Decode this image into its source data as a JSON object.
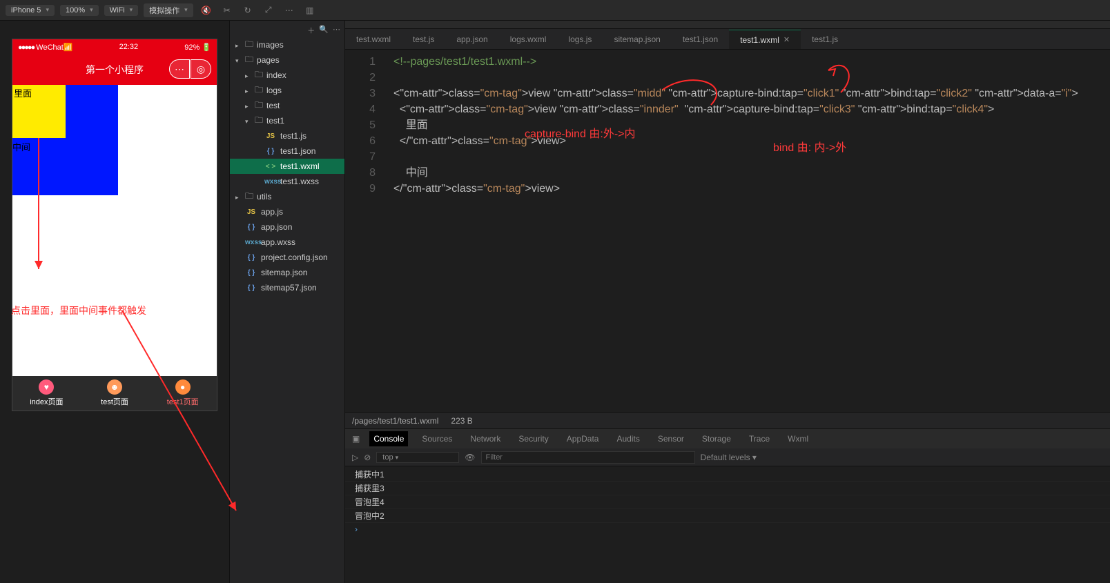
{
  "toolbar": {
    "device": "iPhone 5",
    "zoom": "100%",
    "network": "WiFi",
    "mock": "模拟操作"
  },
  "simulator": {
    "status": {
      "carrier": "WeChat",
      "time": "22:32",
      "battery": "92%"
    },
    "nav_title": "第一个小程序",
    "inner_text": "里面",
    "mid_text": "中间",
    "annotation": "点击里面，里面中间事件都触发",
    "tabs": [
      "index页面",
      "test页面",
      "test1页面"
    ]
  },
  "tree": {
    "root": [
      {
        "name": "images",
        "type": "folder"
      },
      {
        "name": "pages",
        "type": "folder",
        "open": true,
        "children": [
          {
            "name": "index",
            "type": "folder"
          },
          {
            "name": "logs",
            "type": "folder"
          },
          {
            "name": "test",
            "type": "folder"
          },
          {
            "name": "test1",
            "type": "folder",
            "open": true,
            "children": [
              {
                "name": "test1.js",
                "kind": "js"
              },
              {
                "name": "test1.json",
                "kind": "json"
              },
              {
                "name": "test1.wxml",
                "kind": "wxml",
                "active": true
              },
              {
                "name": "test1.wxss",
                "kind": "wxss"
              }
            ]
          }
        ]
      },
      {
        "name": "utils",
        "type": "folder"
      },
      {
        "name": "app.js",
        "kind": "js"
      },
      {
        "name": "app.json",
        "kind": "json"
      },
      {
        "name": "app.wxss",
        "kind": "wxss"
      },
      {
        "name": "project.config.json",
        "kind": "json"
      },
      {
        "name": "sitemap.json",
        "kind": "json"
      },
      {
        "name": "sitemap57.json",
        "kind": "json"
      }
    ]
  },
  "editor_tabs": [
    "test.wxml",
    "test.js",
    "app.json",
    "logs.wxml",
    "logs.js",
    "sitemap.json",
    "test1.json",
    "test1.wxml",
    "test1.js"
  ],
  "editor_tab_active": "test1.wxml",
  "code_lines": [
    "<!--pages/test1/test1.wxml-->",
    "",
    "<view class=\"midd\" capture-bind:tap=\"click1\" bind:tap=\"click2\" data-a=\"i\">",
    "  <view class=\"innder\"  capture-bind:tap=\"click3\" bind:tap=\"click4\">",
    "    里面",
    "  </view>",
    "",
    "    中间",
    "</view>"
  ],
  "editor_path": "/pages/test1/test1.wxml",
  "editor_size": "223 B",
  "red_notes": {
    "capture": "capture-bind  由:外->内",
    "bind": "bind  由: 内->外"
  },
  "devtools": {
    "tabs": [
      "Console",
      "Sources",
      "Network",
      "Security",
      "AppData",
      "Audits",
      "Sensor",
      "Storage",
      "Trace",
      "Wxml"
    ],
    "active": "Console",
    "scope": "top",
    "filter_placeholder": "Filter",
    "levels": "Default levels ▾",
    "logs": [
      "捕获中1",
      "捕获里3",
      "冒泡里4",
      "冒泡中2"
    ]
  }
}
